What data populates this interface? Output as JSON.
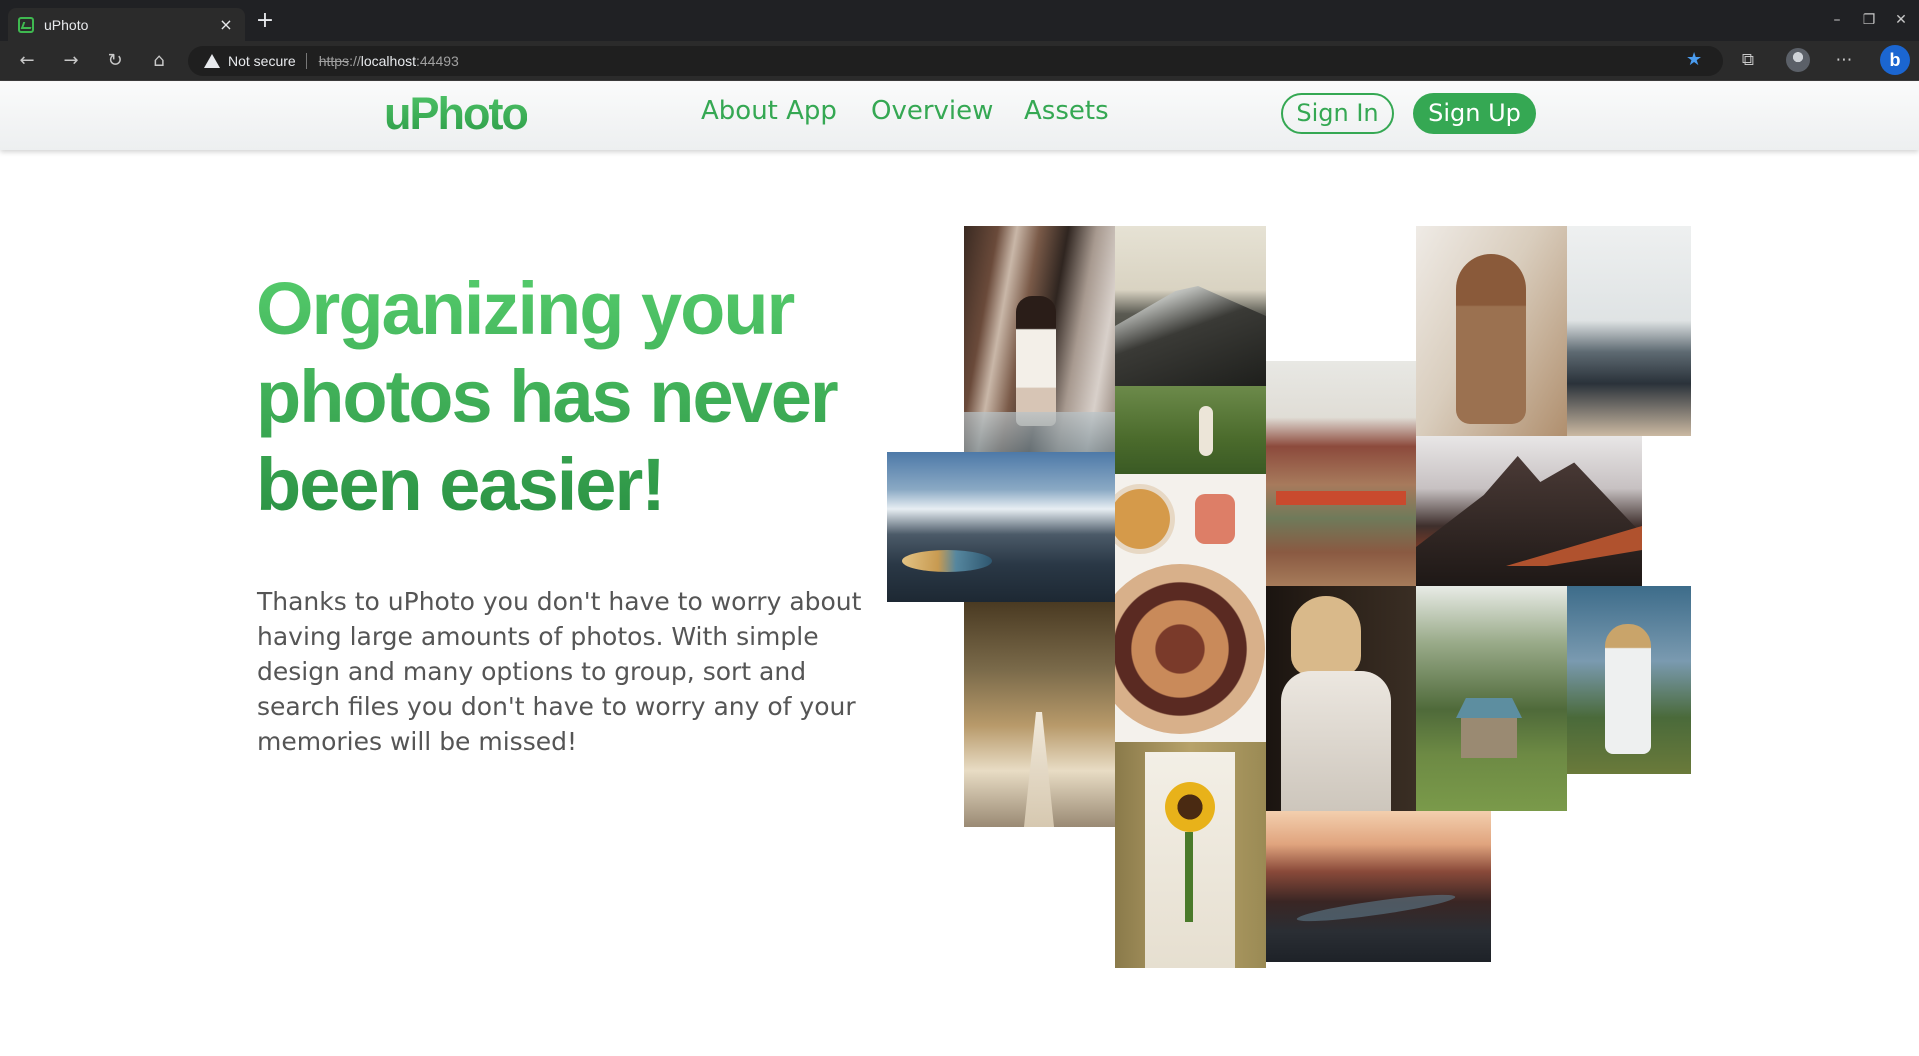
{
  "browser": {
    "tab_title": "uPhoto",
    "tab_close": "×",
    "new_tab": "+",
    "window_controls": {
      "minimize": "–",
      "restore": "❐",
      "close": "✕"
    },
    "nav": {
      "back": "←",
      "forward": "→",
      "reload": "↻",
      "home": "⌂"
    },
    "security_label": "Not secure",
    "url": {
      "scheme": "https",
      "separator": "://",
      "host": "localhost",
      "port": ":44493"
    },
    "toolbar_icons": [
      "star-icon",
      "extensions-icon",
      "profile-avatar",
      "more-icon",
      "bing-icon"
    ],
    "more_glyph": "⋯",
    "extensions_glyph": "⧉",
    "star_glyph": "★",
    "bing_glyph": "b"
  },
  "header": {
    "logo": "uPhoto",
    "nav": [
      {
        "label": "About App"
      },
      {
        "label": "Overview"
      },
      {
        "label": "Assets"
      }
    ],
    "sign_in": "Sign In",
    "sign_up": "Sign Up"
  },
  "hero": {
    "title": "Organizing your photos has never been easier!",
    "description": "Thanks to uPhoto you don't have to worry about having large amounts of photos. With simple design and many options to group, sort and search files you don't have to worry any of your memories will be missed!"
  },
  "colors": {
    "brand_green": "#35a853",
    "brand_green_light": "#55cc6c",
    "text_gray": "#555555"
  },
  "collage": {
    "photos": [
      {
        "name": "photo-couple-pier"
      },
      {
        "name": "photo-mountain-summit"
      },
      {
        "name": "photo-woman-meadow"
      },
      {
        "name": "photo-woman-portrait"
      },
      {
        "name": "photo-seagulls-rocks"
      },
      {
        "name": "photo-mountain-lake"
      },
      {
        "name": "photo-castle-village"
      },
      {
        "name": "photo-rocky-peak"
      },
      {
        "name": "photo-food-platter"
      },
      {
        "name": "photo-cypress-alley"
      },
      {
        "name": "photo-woman-reading"
      },
      {
        "name": "photo-mountain-house"
      },
      {
        "name": "photo-woman-field-hat"
      },
      {
        "name": "photo-sunflower-bouquet"
      },
      {
        "name": "photo-mountain-valley"
      }
    ]
  }
}
